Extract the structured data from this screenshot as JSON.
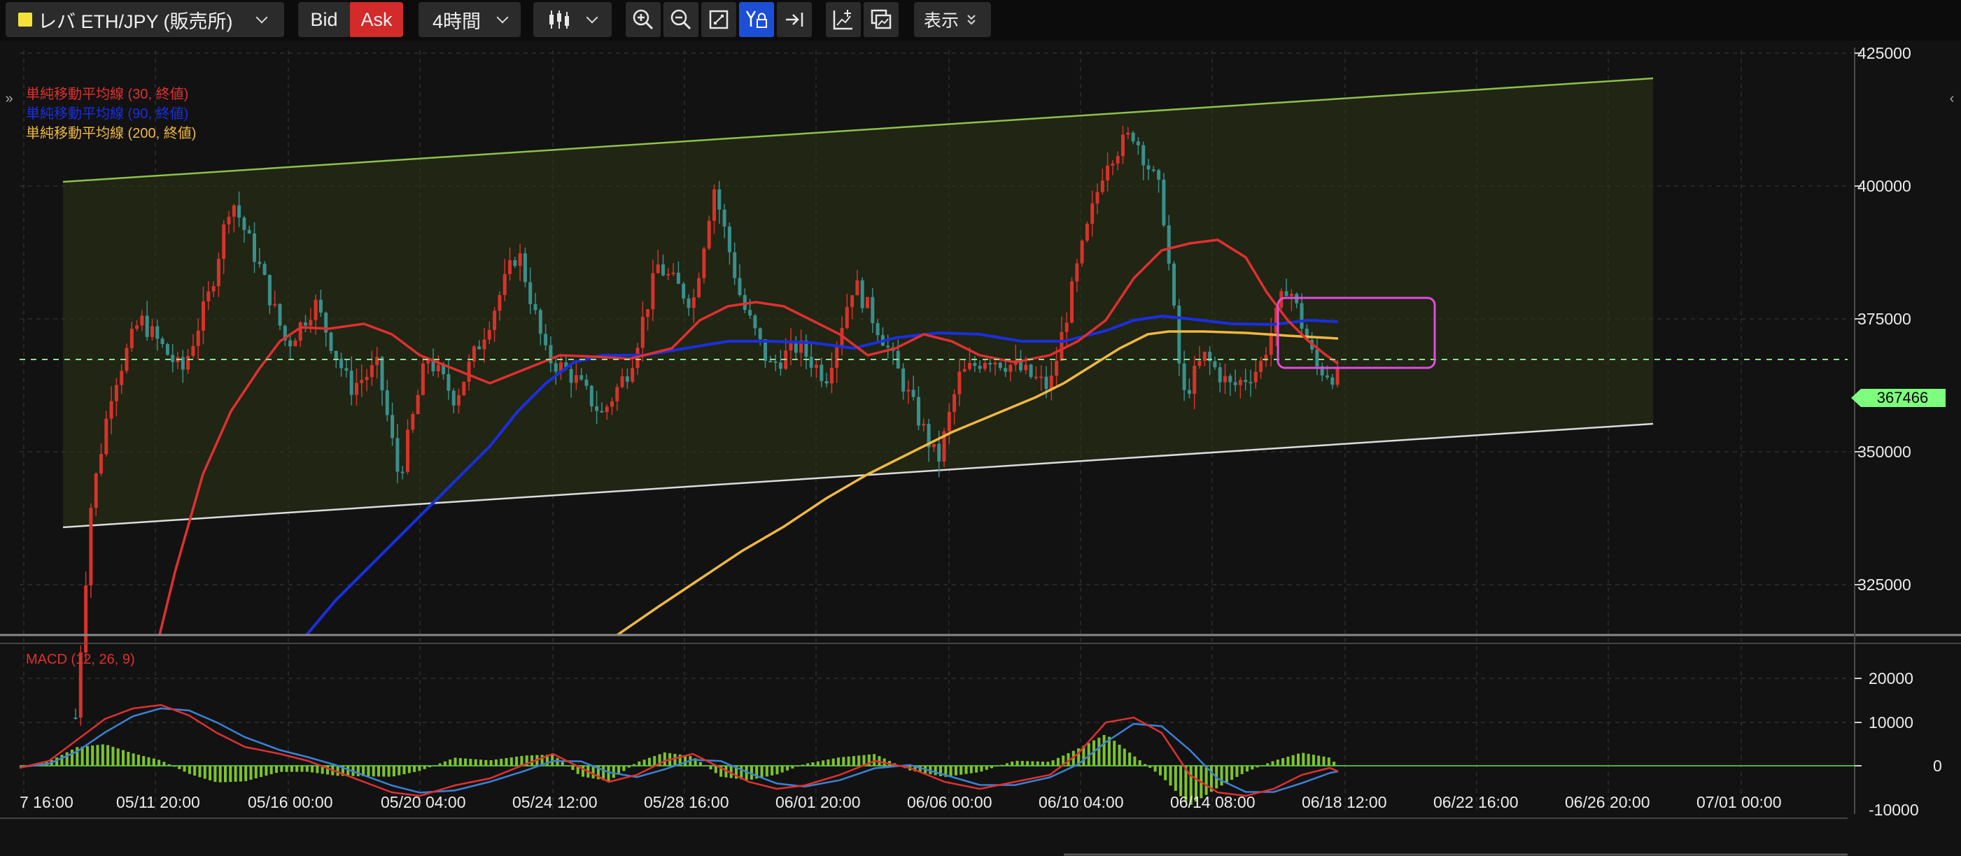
{
  "toolbar": {
    "symbol": "レバ ETH/JPY (販売所)",
    "symbol_color": "#f4e23a",
    "bid_label": "Bid",
    "ask_label": "Ask",
    "ask_color": "#d32a2a",
    "interval": "4時間",
    "chart_type_icon": "candlestick-icon",
    "tools": [
      "zoom-in-icon",
      "zoom-out-icon",
      "fit-screen-icon",
      "price-scale-lock-icon",
      "scroll-to-end-icon",
      "add-indicator-icon",
      "compare-icon"
    ],
    "display_label": "表示"
  },
  "price_axis": {
    "ticks": [
      "425000",
      "400000",
      "375000",
      "350000",
      "325000"
    ],
    "current_price": "367466",
    "current_price_color": "#7dff7d"
  },
  "legend": {
    "sma30": "単純移動平均線 (30, 終値)",
    "sma30_color": "#e03030",
    "sma90": "単純移動平均線 (90, 終値)",
    "sma90_color": "#1a2fe0",
    "sma200": "単純移動平均線 (200, 終値)",
    "sma200_color": "#f0b840"
  },
  "macd": {
    "label": "MACD (12, 26, 9)",
    "ticks": [
      "20000",
      "10000",
      "0",
      "-10000"
    ]
  },
  "time_axis": {
    "labels": [
      "7 16:00",
      "05/11 20:00",
      "05/16 00:00",
      "05/20 04:00",
      "05/24 12:00",
      "05/28 16:00",
      "06/01 20:00",
      "06/06 00:00",
      "06/10 04:00",
      "06/14 08:00",
      "06/18 12:00",
      "06/22 16:00",
      "06/26 20:00",
      "07/01 00:00"
    ]
  },
  "colors": {
    "up_candle": "#d6332b",
    "down_candle": "#3a8f8b",
    "channel_upper": "#8dc24a",
    "channel_lower": "#dcdcdc",
    "highlight_box": "#e04de0",
    "macd_hist": "#7cc42a",
    "macd_line": "#e03030",
    "signal_line": "#3b82d6"
  }
}
